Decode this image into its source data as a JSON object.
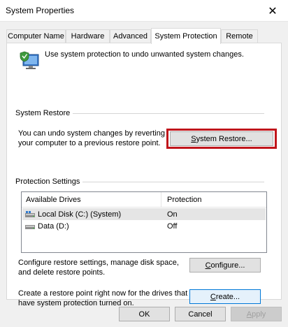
{
  "window": {
    "title": "System Properties",
    "close_glyph": "✕"
  },
  "tabs": [
    {
      "label": "Computer Name",
      "active": false
    },
    {
      "label": "Hardware",
      "active": false
    },
    {
      "label": "Advanced",
      "active": false
    },
    {
      "label": "System Protection",
      "active": true
    },
    {
      "label": "Remote",
      "active": false
    }
  ],
  "intro": {
    "icon": "computer-shield-icon",
    "text": "Use system protection to undo unwanted system changes."
  },
  "system_restore": {
    "group_label": "System Restore",
    "description_line1": "You can undo system changes by reverting",
    "description_line2": "your computer to a previous restore point.",
    "button_prefix": "S",
    "button_label_rest": "ystem Restore...",
    "highlight_color": "#c0151b"
  },
  "protection": {
    "group_label": "Protection Settings",
    "columns": [
      "Available Drives",
      "Protection"
    ],
    "drives": [
      {
        "name": "Local Disk (C:) (System)",
        "protection": "On",
        "icon": "system-drive-icon",
        "selected": true
      },
      {
        "name": "Data (D:)",
        "protection": "Off",
        "icon": "drive-icon",
        "selected": false
      }
    ],
    "configure_line1": "Configure restore settings, manage disk space,",
    "configure_line2": "and delete restore points.",
    "configure_prefix": "C",
    "configure_rest": "onfigure...",
    "create_line1": "Create a restore point right now for the drives that",
    "create_line2": "have system protection turned on.",
    "create_prefix": "C",
    "create_rest": "reate..."
  },
  "footer": {
    "ok": "OK",
    "cancel": "Cancel",
    "apply_prefix": "A",
    "apply_rest": "pply"
  },
  "colors": {
    "accent": "#0078d7",
    "dialog_bg": "#f0f0f0",
    "selection": "#e5e5e5"
  }
}
